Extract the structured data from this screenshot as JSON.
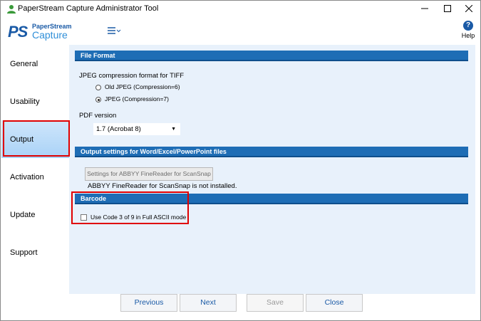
{
  "window": {
    "title": "PaperStream Capture Administrator Tool",
    "min_icon": "minimize-icon",
    "max_icon": "maximize-icon",
    "close_icon": "close-icon"
  },
  "header": {
    "logo_mark": "PS",
    "logo_top": "PaperStream",
    "logo_bottom": "Capture",
    "menu_icon": "hamburger-menu-icon",
    "help_label": "Help",
    "help_glyph": "?"
  },
  "sidebar": {
    "items": [
      {
        "label": "General",
        "active": false
      },
      {
        "label": "Usability",
        "active": false
      },
      {
        "label": "Output",
        "active": true
      },
      {
        "label": "Activation",
        "active": false
      },
      {
        "label": "Update",
        "active": false
      },
      {
        "label": "Support",
        "active": false
      }
    ]
  },
  "file_format": {
    "section_title": "File Format",
    "jpeg_label": "JPEG compression format for TIFF",
    "options": [
      {
        "label": "Old JPEG (Compression=6)",
        "selected": false
      },
      {
        "label": "JPEG (Compression=7)",
        "selected": true
      }
    ],
    "pdf_label": "PDF version",
    "pdf_value": "1.7 (Acrobat 8)"
  },
  "output_settings": {
    "section_title": "Output settings for Word/Excel/PowerPoint files",
    "abbyy_button": "Settings for ABBYY FineReader for ScanSnap",
    "abbyy_status": "ABBYY FineReader for ScanSnap is not installed."
  },
  "barcode": {
    "section_title": "Barcode",
    "checkbox_label": "Use Code 3 of 9 in Full ASCII mode",
    "checked": false
  },
  "footer": {
    "previous": "Previous",
    "next": "Next",
    "save": "Save",
    "close": "Close"
  },
  "colors": {
    "section_bar": "#1e6db5",
    "content_bg": "#e8f1fb",
    "highlight": "#e00000",
    "brand": "#1a5aa6"
  }
}
